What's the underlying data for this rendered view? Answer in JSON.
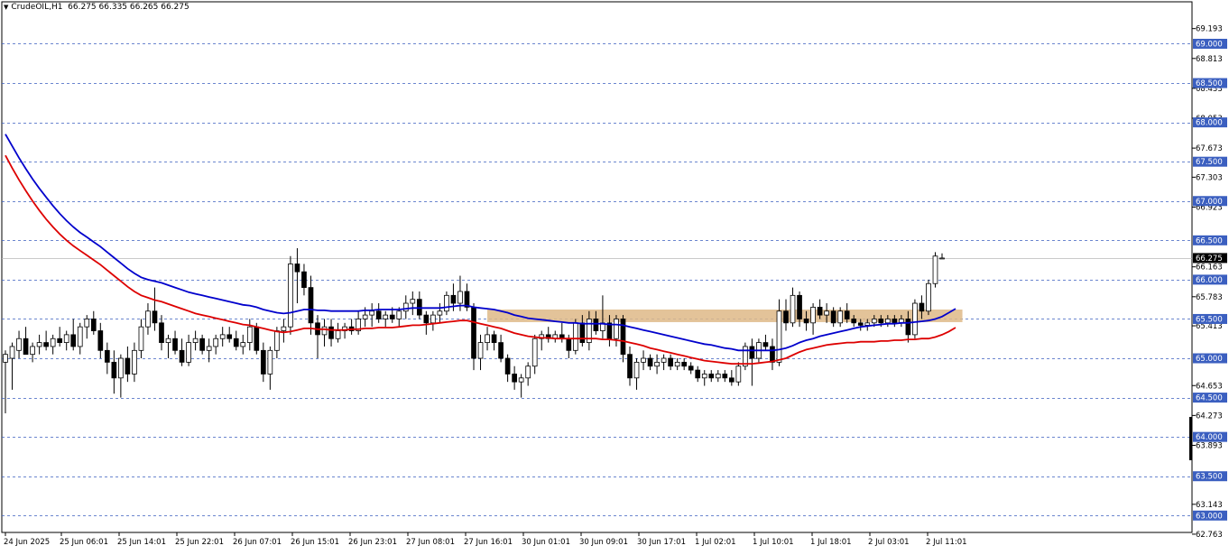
{
  "header": {
    "symbol": "CrudeOIL,H1",
    "ohlc": "66.275 66.335 66.265 66.275"
  },
  "chart_data": {
    "type": "candlestick",
    "symbol": "CrudeOIL",
    "timeframe": "H1",
    "ylim": [
      62.9,
      69.35
    ],
    "price_ticks": [
      "69.193",
      "68.813",
      "68.433",
      "68.053",
      "67.673",
      "67.303",
      "66.923",
      "66.163",
      "65.783",
      "65.413",
      "64.653",
      "64.273",
      "63.893",
      "63.143",
      "62.763"
    ],
    "level_lines": [
      "69.000",
      "68.500",
      "68.000",
      "67.500",
      "67.000",
      "66.500",
      "66.000",
      "65.500",
      "65.000",
      "64.500",
      "64.000",
      "63.500",
      "63.000"
    ],
    "current_price": "66.275",
    "x_labels": [
      "24 Jun 2025",
      "25 Jun 06:01",
      "25 Jun 14:01",
      "25 Jun 22:01",
      "26 Jun 07:01",
      "26 Jun 15:01",
      "26 Jun 23:01",
      "27 Jun 08:01",
      "27 Jun 16:01",
      "30 Jun 01:01",
      "30 Jun 09:01",
      "30 Jun 17:01",
      "1 Jul 02:01",
      "1 Jul 10:01",
      "1 Jul 18:01",
      "2 Jul 03:01",
      "2 Jul 11:01"
    ],
    "candles": [
      {
        "o": 64.95,
        "h": 65.1,
        "l": 64.3,
        "c": 65.05
      },
      {
        "o": 65.0,
        "h": 65.2,
        "l": 64.6,
        "c": 65.15
      },
      {
        "o": 65.1,
        "h": 65.35,
        "l": 65.0,
        "c": 65.25
      },
      {
        "o": 65.25,
        "h": 65.4,
        "l": 65.1,
        "c": 65.05
      },
      {
        "o": 65.05,
        "h": 65.2,
        "l": 64.95,
        "c": 65.15
      },
      {
        "o": 65.15,
        "h": 65.3,
        "l": 65.05,
        "c": 65.2
      },
      {
        "o": 65.2,
        "h": 65.35,
        "l": 65.1,
        "c": 65.15
      },
      {
        "o": 65.15,
        "h": 65.3,
        "l": 65.05,
        "c": 65.25
      },
      {
        "o": 65.25,
        "h": 65.4,
        "l": 65.15,
        "c": 65.2
      },
      {
        "o": 65.2,
        "h": 65.35,
        "l": 65.1,
        "c": 65.3
      },
      {
        "o": 65.3,
        "h": 65.5,
        "l": 65.1,
        "c": 65.15
      },
      {
        "o": 65.15,
        "h": 65.45,
        "l": 65.05,
        "c": 65.4
      },
      {
        "o": 65.4,
        "h": 65.55,
        "l": 65.25,
        "c": 65.5
      },
      {
        "o": 65.5,
        "h": 65.6,
        "l": 65.3,
        "c": 65.35
      },
      {
        "o": 65.35,
        "h": 65.45,
        "l": 65.0,
        "c": 65.1
      },
      {
        "o": 65.1,
        "h": 65.2,
        "l": 64.8,
        "c": 64.95
      },
      {
        "o": 64.95,
        "h": 65.1,
        "l": 64.55,
        "c": 64.75
      },
      {
        "o": 64.75,
        "h": 65.05,
        "l": 64.5,
        "c": 65.0
      },
      {
        "o": 65.0,
        "h": 65.15,
        "l": 64.7,
        "c": 64.8
      },
      {
        "o": 64.8,
        "h": 65.2,
        "l": 64.7,
        "c": 65.1
      },
      {
        "o": 65.1,
        "h": 65.5,
        "l": 65.0,
        "c": 65.4
      },
      {
        "o": 65.4,
        "h": 65.7,
        "l": 65.3,
        "c": 65.6
      },
      {
        "o": 65.6,
        "h": 65.9,
        "l": 65.35,
        "c": 65.45
      },
      {
        "o": 65.45,
        "h": 65.55,
        "l": 65.1,
        "c": 65.2
      },
      {
        "o": 65.2,
        "h": 65.3,
        "l": 65.0,
        "c": 65.25
      },
      {
        "o": 65.25,
        "h": 65.35,
        "l": 65.05,
        "c": 65.1
      },
      {
        "o": 65.1,
        "h": 65.25,
        "l": 64.9,
        "c": 64.95
      },
      {
        "o": 64.95,
        "h": 65.3,
        "l": 64.9,
        "c": 65.2
      },
      {
        "o": 65.2,
        "h": 65.35,
        "l": 65.1,
        "c": 65.25
      },
      {
        "o": 65.25,
        "h": 65.3,
        "l": 65.05,
        "c": 65.1
      },
      {
        "o": 65.1,
        "h": 65.25,
        "l": 64.95,
        "c": 65.15
      },
      {
        "o": 65.15,
        "h": 65.3,
        "l": 65.05,
        "c": 65.25
      },
      {
        "o": 65.25,
        "h": 65.4,
        "l": 65.15,
        "c": 65.3
      },
      {
        "o": 65.3,
        "h": 65.4,
        "l": 65.2,
        "c": 65.25
      },
      {
        "o": 65.25,
        "h": 65.35,
        "l": 65.1,
        "c": 65.15
      },
      {
        "o": 65.15,
        "h": 65.3,
        "l": 65.05,
        "c": 65.2
      },
      {
        "o": 65.2,
        "h": 65.5,
        "l": 65.1,
        "c": 65.4
      },
      {
        "o": 65.4,
        "h": 65.45,
        "l": 65.05,
        "c": 65.1
      },
      {
        "o": 65.1,
        "h": 65.2,
        "l": 64.7,
        "c": 64.8
      },
      {
        "o": 64.8,
        "h": 65.15,
        "l": 64.6,
        "c": 65.1
      },
      {
        "o": 65.1,
        "h": 65.4,
        "l": 65.0,
        "c": 65.35
      },
      {
        "o": 65.35,
        "h": 65.5,
        "l": 65.2,
        "c": 65.4
      },
      {
        "o": 65.4,
        "h": 66.3,
        "l": 65.3,
        "c": 66.2
      },
      {
        "o": 66.2,
        "h": 66.4,
        "l": 65.7,
        "c": 66.1
      },
      {
        "o": 66.1,
        "h": 66.2,
        "l": 65.8,
        "c": 65.9
      },
      {
        "o": 65.9,
        "h": 66.05,
        "l": 65.3,
        "c": 65.45
      },
      {
        "o": 65.45,
        "h": 65.55,
        "l": 65.0,
        "c": 65.3
      },
      {
        "o": 65.3,
        "h": 65.5,
        "l": 65.15,
        "c": 65.4
      },
      {
        "o": 65.4,
        "h": 65.5,
        "l": 65.15,
        "c": 65.25
      },
      {
        "o": 65.25,
        "h": 65.45,
        "l": 65.2,
        "c": 65.35
      },
      {
        "o": 65.35,
        "h": 65.45,
        "l": 65.25,
        "c": 65.4
      },
      {
        "o": 65.4,
        "h": 65.5,
        "l": 65.3,
        "c": 65.35
      },
      {
        "o": 65.35,
        "h": 65.6,
        "l": 65.3,
        "c": 65.5
      },
      {
        "o": 65.5,
        "h": 65.65,
        "l": 65.4,
        "c": 65.55
      },
      {
        "o": 65.55,
        "h": 65.7,
        "l": 65.4,
        "c": 65.6
      },
      {
        "o": 65.6,
        "h": 65.7,
        "l": 65.45,
        "c": 65.5
      },
      {
        "o": 65.5,
        "h": 65.6,
        "l": 65.4,
        "c": 65.55
      },
      {
        "o": 65.55,
        "h": 65.65,
        "l": 65.45,
        "c": 65.5
      },
      {
        "o": 65.5,
        "h": 65.65,
        "l": 65.4,
        "c": 65.6
      },
      {
        "o": 65.6,
        "h": 65.8,
        "l": 65.5,
        "c": 65.7
      },
      {
        "o": 65.7,
        "h": 65.85,
        "l": 65.55,
        "c": 65.75
      },
      {
        "o": 65.75,
        "h": 65.85,
        "l": 65.5,
        "c": 65.55
      },
      {
        "o": 65.55,
        "h": 65.6,
        "l": 65.3,
        "c": 65.45
      },
      {
        "o": 65.45,
        "h": 65.6,
        "l": 65.35,
        "c": 65.55
      },
      {
        "o": 65.55,
        "h": 65.7,
        "l": 65.45,
        "c": 65.6
      },
      {
        "o": 65.6,
        "h": 65.85,
        "l": 65.55,
        "c": 65.8
      },
      {
        "o": 65.8,
        "h": 65.95,
        "l": 65.6,
        "c": 65.7
      },
      {
        "o": 65.7,
        "h": 66.05,
        "l": 65.6,
        "c": 65.85
      },
      {
        "o": 65.85,
        "h": 65.95,
        "l": 65.6,
        "c": 65.65
      },
      {
        "o": 65.65,
        "h": 65.7,
        "l": 64.85,
        "c": 65.0
      },
      {
        "o": 65.0,
        "h": 65.3,
        "l": 64.85,
        "c": 65.2
      },
      {
        "o": 65.2,
        "h": 65.4,
        "l": 65.1,
        "c": 65.3
      },
      {
        "o": 65.3,
        "h": 65.35,
        "l": 65.1,
        "c": 65.2
      },
      {
        "o": 65.2,
        "h": 65.3,
        "l": 64.95,
        "c": 65.0
      },
      {
        "o": 65.0,
        "h": 65.05,
        "l": 64.7,
        "c": 64.8
      },
      {
        "o": 64.8,
        "h": 64.9,
        "l": 64.6,
        "c": 64.7
      },
      {
        "o": 64.7,
        "h": 64.8,
        "l": 64.5,
        "c": 64.75
      },
      {
        "o": 64.75,
        "h": 64.95,
        "l": 64.65,
        "c": 64.9
      },
      {
        "o": 64.9,
        "h": 65.3,
        "l": 64.8,
        "c": 65.25
      },
      {
        "o": 65.25,
        "h": 65.35,
        "l": 65.1,
        "c": 65.3
      },
      {
        "o": 65.3,
        "h": 65.4,
        "l": 65.2,
        "c": 65.25
      },
      {
        "o": 65.25,
        "h": 65.35,
        "l": 65.2,
        "c": 65.3
      },
      {
        "o": 65.3,
        "h": 65.45,
        "l": 65.2,
        "c": 65.25
      },
      {
        "o": 65.25,
        "h": 65.3,
        "l": 65.0,
        "c": 65.1
      },
      {
        "o": 65.1,
        "h": 65.5,
        "l": 65.05,
        "c": 65.45
      },
      {
        "o": 65.45,
        "h": 65.55,
        "l": 65.15,
        "c": 65.2
      },
      {
        "o": 65.2,
        "h": 65.6,
        "l": 65.1,
        "c": 65.5
      },
      {
        "o": 65.5,
        "h": 65.6,
        "l": 65.3,
        "c": 65.35
      },
      {
        "o": 65.35,
        "h": 65.8,
        "l": 65.25,
        "c": 65.45
      },
      {
        "o": 65.45,
        "h": 65.55,
        "l": 65.15,
        "c": 65.25
      },
      {
        "o": 65.25,
        "h": 65.55,
        "l": 65.15,
        "c": 65.5
      },
      {
        "o": 65.5,
        "h": 65.55,
        "l": 64.95,
        "c": 65.05
      },
      {
        "o": 65.05,
        "h": 65.15,
        "l": 64.65,
        "c": 64.75
      },
      {
        "o": 64.75,
        "h": 65.0,
        "l": 64.6,
        "c": 64.95
      },
      {
        "o": 64.95,
        "h": 65.1,
        "l": 64.85,
        "c": 65.0
      },
      {
        "o": 65.0,
        "h": 65.05,
        "l": 64.85,
        "c": 64.9
      },
      {
        "o": 64.9,
        "h": 65.05,
        "l": 64.8,
        "c": 64.95
      },
      {
        "o": 64.95,
        "h": 65.05,
        "l": 64.85,
        "c": 65.0
      },
      {
        "o": 65.0,
        "h": 65.05,
        "l": 64.85,
        "c": 64.9
      },
      {
        "o": 64.9,
        "h": 65.0,
        "l": 64.85,
        "c": 64.95
      },
      {
        "o": 64.95,
        "h": 65.0,
        "l": 64.85,
        "c": 64.9
      },
      {
        "o": 64.9,
        "h": 64.95,
        "l": 64.8,
        "c": 64.85
      },
      {
        "o": 64.85,
        "h": 64.9,
        "l": 64.7,
        "c": 64.75
      },
      {
        "o": 64.75,
        "h": 64.85,
        "l": 64.65,
        "c": 64.8
      },
      {
        "o": 64.8,
        "h": 64.85,
        "l": 64.7,
        "c": 64.75
      },
      {
        "o": 64.75,
        "h": 64.85,
        "l": 64.7,
        "c": 64.8
      },
      {
        "o": 64.8,
        "h": 64.85,
        "l": 64.7,
        "c": 64.75
      },
      {
        "o": 64.75,
        "h": 64.85,
        "l": 64.65,
        "c": 64.7
      },
      {
        "o": 64.7,
        "h": 64.95,
        "l": 64.65,
        "c": 64.9
      },
      {
        "o": 64.9,
        "h": 65.2,
        "l": 64.85,
        "c": 65.15
      },
      {
        "o": 65.15,
        "h": 65.25,
        "l": 64.65,
        "c": 65.0
      },
      {
        "o": 65.0,
        "h": 65.25,
        "l": 64.95,
        "c": 65.2
      },
      {
        "o": 65.2,
        "h": 65.3,
        "l": 65.1,
        "c": 65.15
      },
      {
        "o": 65.15,
        "h": 65.25,
        "l": 64.85,
        "c": 64.95
      },
      {
        "o": 64.95,
        "h": 65.75,
        "l": 64.9,
        "c": 65.6
      },
      {
        "o": 65.6,
        "h": 65.75,
        "l": 65.35,
        "c": 65.45
      },
      {
        "o": 65.45,
        "h": 65.9,
        "l": 65.4,
        "c": 65.8
      },
      {
        "o": 65.8,
        "h": 65.85,
        "l": 65.4,
        "c": 65.5
      },
      {
        "o": 65.5,
        "h": 65.6,
        "l": 65.35,
        "c": 65.45
      },
      {
        "o": 65.45,
        "h": 65.7,
        "l": 65.3,
        "c": 65.65
      },
      {
        "o": 65.65,
        "h": 65.75,
        "l": 65.5,
        "c": 65.55
      },
      {
        "o": 65.55,
        "h": 65.7,
        "l": 65.45,
        "c": 65.6
      },
      {
        "o": 65.6,
        "h": 65.65,
        "l": 65.4,
        "c": 65.45
      },
      {
        "o": 65.45,
        "h": 65.65,
        "l": 65.4,
        "c": 65.6
      },
      {
        "o": 65.6,
        "h": 65.7,
        "l": 65.45,
        "c": 65.5
      },
      {
        "o": 65.5,
        "h": 65.55,
        "l": 65.4,
        "c": 65.45
      },
      {
        "o": 65.45,
        "h": 65.5,
        "l": 65.35,
        "c": 65.42
      },
      {
        "o": 65.42,
        "h": 65.5,
        "l": 65.35,
        "c": 65.45
      },
      {
        "o": 65.45,
        "h": 65.55,
        "l": 65.4,
        "c": 65.5
      },
      {
        "o": 65.5,
        "h": 65.55,
        "l": 65.4,
        "c": 65.45
      },
      {
        "o": 65.45,
        "h": 65.55,
        "l": 65.4,
        "c": 65.5
      },
      {
        "o": 65.5,
        "h": 65.55,
        "l": 65.4,
        "c": 65.45
      },
      {
        "o": 65.45,
        "h": 65.55,
        "l": 65.4,
        "c": 65.5
      },
      {
        "o": 65.5,
        "h": 65.6,
        "l": 65.2,
        "c": 65.3
      },
      {
        "o": 65.3,
        "h": 65.75,
        "l": 65.25,
        "c": 65.7
      },
      {
        "o": 65.7,
        "h": 65.8,
        "l": 65.5,
        "c": 65.6
      },
      {
        "o": 65.6,
        "h": 66.0,
        "l": 65.55,
        "c": 65.95
      },
      {
        "o": 65.95,
        "h": 66.35,
        "l": 65.9,
        "c": 66.3
      },
      {
        "o": 66.275,
        "h": 66.335,
        "l": 66.265,
        "c": 66.275
      }
    ],
    "moving_averages": [
      {
        "color": "#0000cc",
        "values": [
          67.85,
          67.7,
          67.55,
          67.41,
          67.28,
          67.16,
          67.05,
          66.94,
          66.84,
          66.75,
          66.67,
          66.6,
          66.54,
          66.48,
          66.42,
          66.35,
          66.28,
          66.21,
          66.14,
          66.08,
          66.03,
          66.0,
          65.98,
          65.96,
          65.93,
          65.9,
          65.87,
          65.84,
          65.82,
          65.8,
          65.78,
          65.76,
          65.74,
          65.72,
          65.7,
          65.68,
          65.67,
          65.65,
          65.62,
          65.6,
          65.58,
          65.57,
          65.58,
          65.6,
          65.62,
          65.62,
          65.61,
          65.61,
          65.6,
          65.6,
          65.6,
          65.6,
          65.6,
          65.61,
          65.61,
          65.62,
          65.62,
          65.62,
          65.62,
          65.63,
          65.64,
          65.64,
          65.64,
          65.64,
          65.64,
          65.65,
          65.66,
          65.67,
          65.67,
          65.65,
          65.64,
          65.63,
          65.62,
          65.6,
          65.58,
          65.55,
          65.53,
          65.51,
          65.5,
          65.49,
          65.48,
          65.47,
          65.46,
          65.45,
          65.45,
          65.44,
          65.44,
          65.44,
          65.44,
          65.43,
          65.43,
          65.42,
          65.4,
          65.38,
          65.36,
          65.34,
          65.32,
          65.3,
          65.28,
          65.26,
          65.24,
          65.22,
          65.2,
          65.18,
          65.17,
          65.15,
          65.13,
          65.12,
          65.1,
          65.1,
          65.1,
          65.1,
          65.1,
          65.1,
          65.11,
          65.13,
          65.16,
          65.2,
          65.23,
          65.25,
          65.28,
          65.3,
          65.32,
          65.34,
          65.36,
          65.38,
          65.4,
          65.41,
          65.42,
          65.43,
          65.44,
          65.44,
          65.45,
          65.45,
          65.46,
          65.47,
          65.48,
          65.5,
          65.53,
          65.58,
          65.63
        ]
      },
      {
        "color": "#dd0000",
        "values": [
          67.58,
          67.42,
          67.27,
          67.13,
          67.0,
          66.88,
          66.77,
          66.67,
          66.58,
          66.5,
          66.43,
          66.37,
          66.31,
          66.25,
          66.19,
          66.12,
          66.05,
          65.98,
          65.91,
          65.85,
          65.8,
          65.77,
          65.74,
          65.72,
          65.69,
          65.66,
          65.63,
          65.6,
          65.57,
          65.55,
          65.53,
          65.51,
          65.49,
          65.47,
          65.45,
          65.43,
          65.42,
          65.4,
          65.38,
          65.36,
          65.34,
          65.33,
          65.34,
          65.36,
          65.38,
          65.38,
          65.37,
          65.37,
          65.36,
          65.36,
          65.36,
          65.37,
          65.37,
          65.38,
          65.38,
          65.39,
          65.39,
          65.39,
          65.4,
          65.41,
          65.42,
          65.42,
          65.43,
          65.44,
          65.45,
          65.46,
          65.47,
          65.48,
          65.48,
          65.46,
          65.44,
          65.42,
          65.4,
          65.38,
          65.35,
          65.32,
          65.3,
          65.28,
          65.27,
          65.26,
          65.26,
          65.25,
          65.25,
          65.25,
          65.25,
          65.25,
          65.25,
          65.25,
          65.24,
          65.24,
          65.23,
          65.22,
          65.2,
          65.18,
          65.16,
          65.13,
          65.11,
          65.09,
          65.07,
          65.05,
          65.03,
          65.01,
          64.99,
          64.97,
          64.96,
          64.95,
          64.94,
          64.93,
          64.93,
          64.93,
          64.93,
          64.94,
          64.95,
          64.96,
          64.98,
          65.0,
          65.04,
          65.08,
          65.11,
          65.13,
          65.15,
          65.17,
          65.18,
          65.19,
          65.2,
          65.2,
          65.21,
          65.21,
          65.21,
          65.22,
          65.22,
          65.23,
          65.23,
          65.24,
          65.24,
          65.25,
          65.25,
          65.27,
          65.3,
          65.34,
          65.39
        ]
      }
    ],
    "zone": {
      "from_index": 71,
      "to_index": 141,
      "low": 65.46,
      "high": 65.62
    }
  }
}
